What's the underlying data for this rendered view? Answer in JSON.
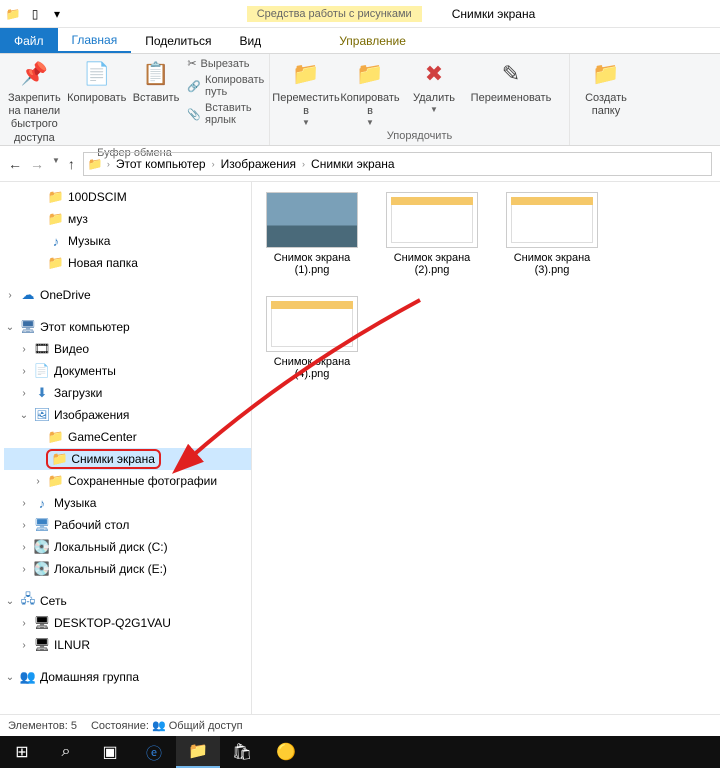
{
  "titlebar": {
    "context_label": "Средства работы с рисунками",
    "window_title": "Снимки экрана"
  },
  "tabs": {
    "file": "Файл",
    "home": "Главная",
    "share": "Поделиться",
    "view": "Вид",
    "manage": "Управление"
  },
  "ribbon": {
    "pin": "Закрепить на панели\nбыстрого доступа",
    "copy": "Копировать",
    "paste": "Вставить",
    "cut": "Вырезать",
    "copy_path": "Копировать путь",
    "paste_shortcut": "Вставить ярлык",
    "clipboard_group": "Буфер обмена",
    "move_to": "Переместить в",
    "copy_to": "Копировать в",
    "delete": "Удалить",
    "rename": "Переименовать",
    "organize_group": "Упорядочить",
    "new_folder": "Создать папку"
  },
  "breadcrumbs": {
    "b1": "Этот компьютер",
    "b2": "Изображения",
    "b3": "Снимки экрана"
  },
  "tree": {
    "dscim": "100DSCIM",
    "muz": "муз",
    "music": "Музыка",
    "newfolder": "Новая папка",
    "onedrive": "OneDrive",
    "thispc": "Этот компьютер",
    "video": "Видео",
    "documents": "Документы",
    "downloads": "Загрузки",
    "pictures": "Изображения",
    "gamecenter": "GameCenter",
    "screenshots": "Снимки экрана",
    "savedphotos": "Сохраненные фотографии",
    "music2": "Музыка",
    "desktop": "Рабочий стол",
    "diskC": "Локальный диск (C:)",
    "diskE": "Локальный диск (E:)",
    "network": "Сеть",
    "desktop_pc": "DESKTOP-Q2G1VAU",
    "ilnur": "ILNUR",
    "homegroup": "Домашняя группа"
  },
  "files": {
    "f1": "Снимок экрана (1).png",
    "f2": "Снимок экрана (2).png",
    "f3": "Снимок экрана (3).png",
    "f4": "Снимок экрана (4).png"
  },
  "status": {
    "count_label": "Элементов: 5",
    "state_label": "Состояние:",
    "share_label": "Общий доступ"
  }
}
